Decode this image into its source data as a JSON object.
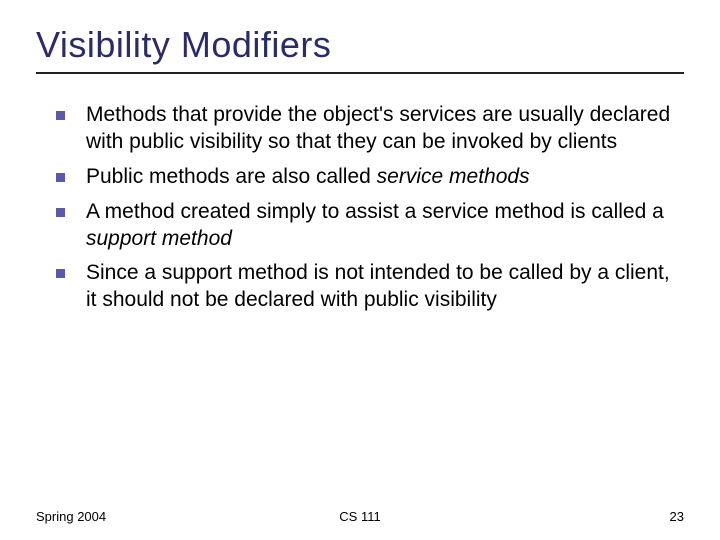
{
  "slide": {
    "title": "Visibility Modifiers",
    "bullets": [
      {
        "html": "Methods that provide the object's services are usually declared with public visibility so that they can be invoked by clients"
      },
      {
        "html": "Public methods are also called <span class=\"italic\">service methods</span>"
      },
      {
        "html": "A method created simply to assist a service method is called a <span class=\"italic\">support method</span>"
      },
      {
        "html": "Since a support method is not intended to be called by a client, it should not be declared with public visibility"
      }
    ]
  },
  "footer": {
    "left": "Spring 2004",
    "center": "CS 111",
    "right": "23"
  }
}
